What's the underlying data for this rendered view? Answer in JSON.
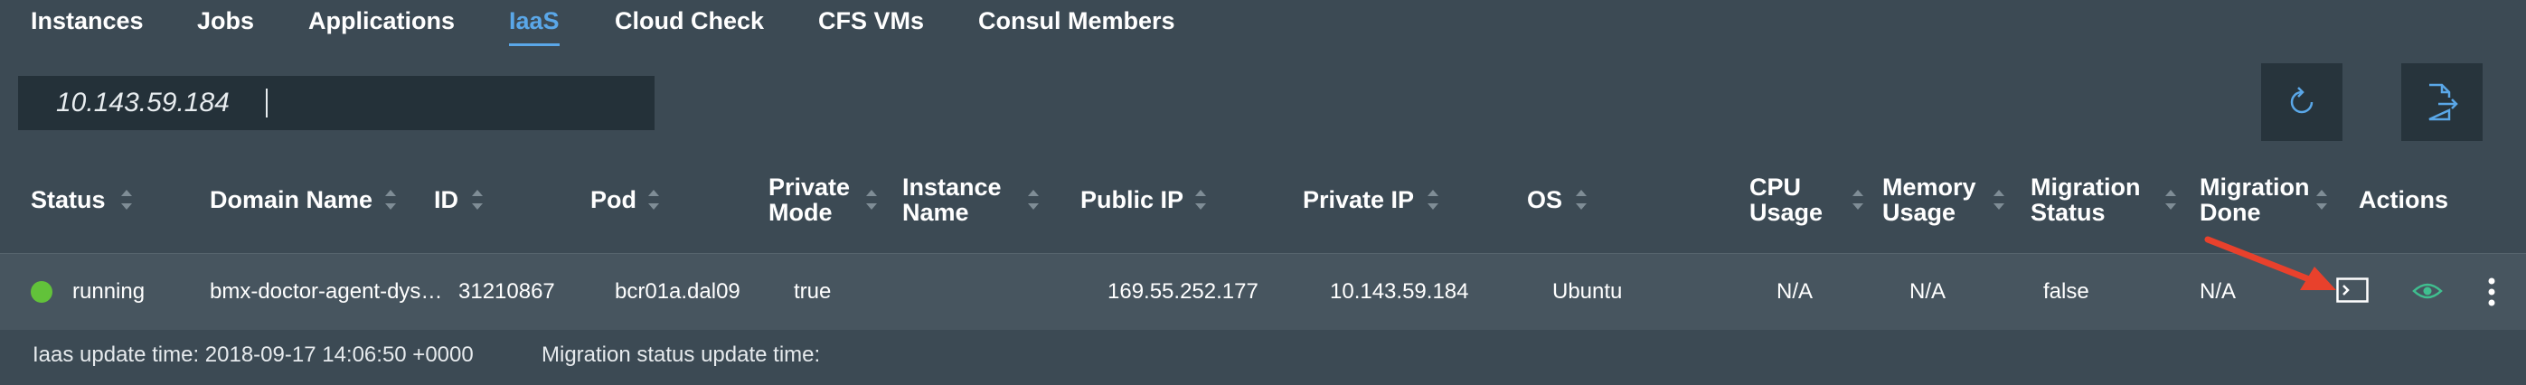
{
  "nav": {
    "tabs": [
      {
        "label": "Instances"
      },
      {
        "label": "Jobs"
      },
      {
        "label": "Applications"
      },
      {
        "label": "IaaS"
      },
      {
        "label": "Cloud Check"
      },
      {
        "label": "CFS VMs"
      },
      {
        "label": "Consul Members"
      }
    ],
    "active_tab": "IaaS"
  },
  "search": {
    "value": "10.143.59.184",
    "placeholder": ""
  },
  "toolbar": {
    "refresh_icon": "refresh-icon",
    "export_icon": "export-icon"
  },
  "table": {
    "headers": {
      "status": "Status",
      "domain": "Domain Name",
      "id": "ID",
      "pod": "Pod",
      "private_mode_1": "Private",
      "private_mode_2": "Mode",
      "instance_name_1": "Instance",
      "instance_name_2": "Name",
      "public_ip": "Public IP",
      "private_ip": "Private IP",
      "os": "OS",
      "cpu_1": "CPU",
      "cpu_2": "Usage",
      "memory_1": "Memory",
      "memory_2": "Usage",
      "migration_status_1": "Migration",
      "migration_status_2": "Status",
      "migration_done_1": "Migration",
      "migration_done_2": "Done",
      "actions": "Actions"
    },
    "rows": [
      {
        "status": "running",
        "domain": "bmx-doctor-agent-dys…",
        "id": "31210867",
        "pod": "bcr01a.dal09",
        "private_mode": "true",
        "instance_name": "",
        "public_ip": "169.55.252.177",
        "private_ip": "10.143.59.184",
        "os": "Ubuntu",
        "cpu": "N/A",
        "memory": "N/A",
        "migration_status": "false",
        "migration_done": "N/A"
      }
    ]
  },
  "footer": {
    "iaas_update": "Iaas update time: 2018-09-17 14:06:50 +0000",
    "migration_update": "Migration status update time:"
  },
  "colors": {
    "accent": "#5aa7e8",
    "running": "#62c23a",
    "annotation_arrow": "#e8412c",
    "view_icon": "#3fbf8f"
  }
}
